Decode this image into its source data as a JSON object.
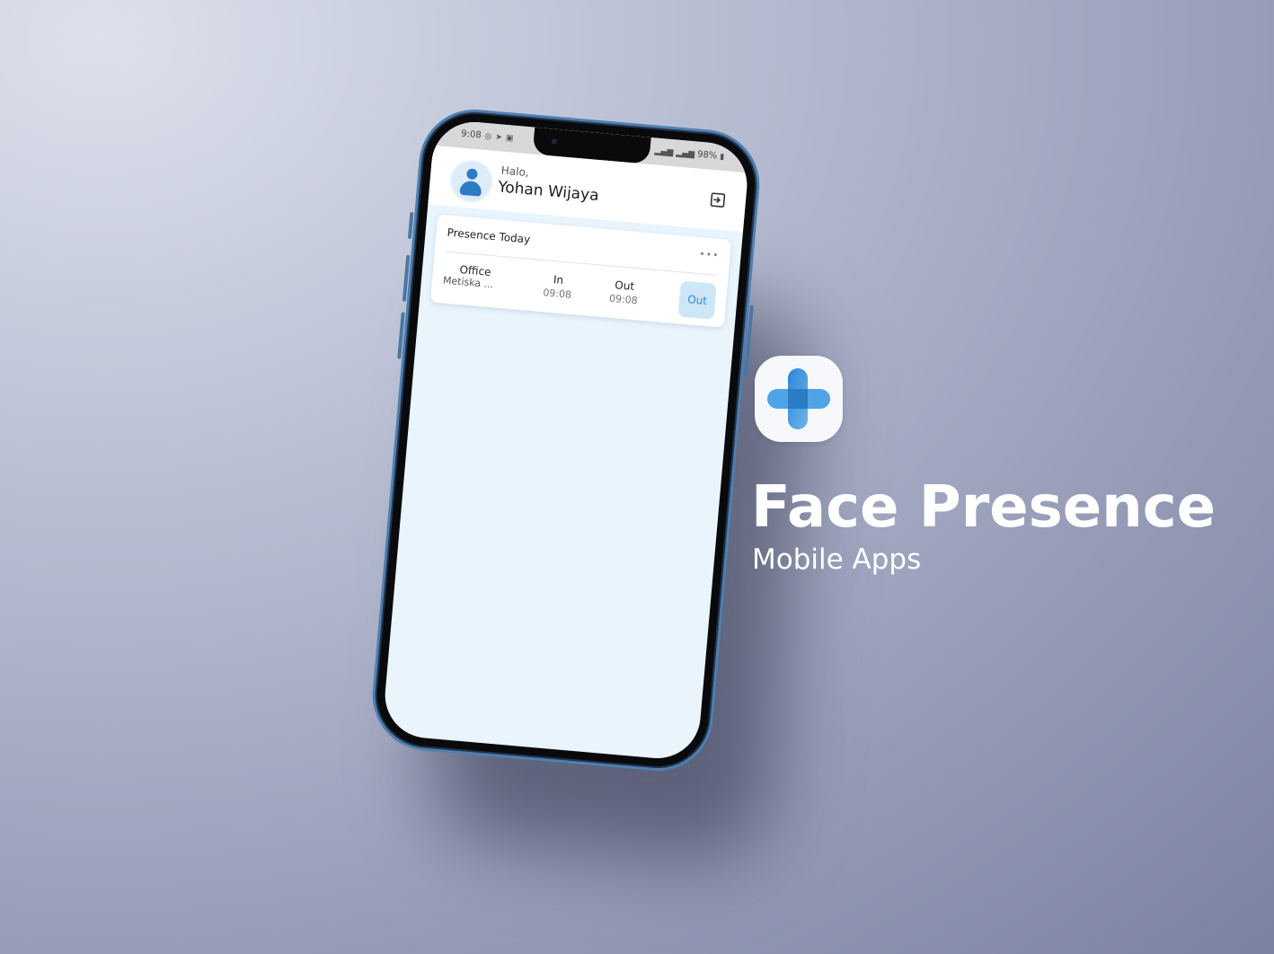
{
  "status_bar": {
    "time": "9:08",
    "battery": "98%"
  },
  "header": {
    "greeting": "Halo,",
    "user_name": "Yohan Wijaya"
  },
  "presence_card": {
    "title": "Presence Today",
    "more": "•••",
    "office_label": "Office",
    "office_value": "Metiska ...",
    "in_label": "In",
    "in_time": "09:08",
    "out_label": "Out",
    "out_time": "09:08",
    "out_button": "Out"
  },
  "promo": {
    "title": "Face Presence",
    "subtitle": "Mobile Apps"
  },
  "colors": {
    "accent": "#2d8bd3",
    "screen_bg": "#e9f4fd",
    "phone_frame": "#4f7fae"
  },
  "icons": {
    "avatar": "user-avatar-icon",
    "logout": "logout-icon",
    "app": "blue-plus-app-icon"
  }
}
